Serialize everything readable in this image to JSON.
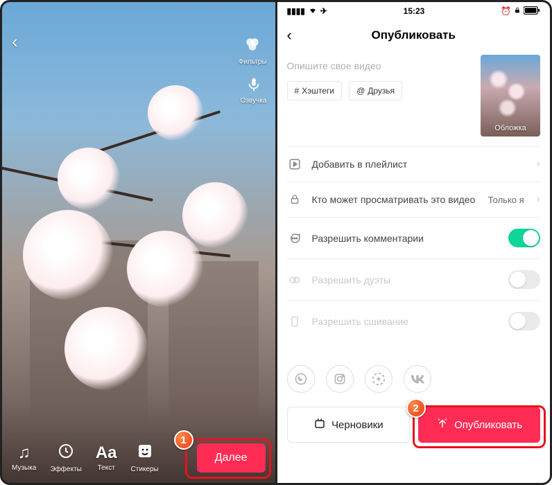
{
  "left": {
    "side": {
      "filters": "Фильтры",
      "voice": "Озвучка"
    },
    "tools": {
      "music": "Музыка",
      "effects": "Эффекты",
      "text": "Текст",
      "stickers": "Стикеры"
    },
    "next": "Далее",
    "badge": "1"
  },
  "right": {
    "status": {
      "time": "15:23"
    },
    "nav": {
      "title": "Опубликовать"
    },
    "compose": {
      "placeholder": "Опишите свое видео",
      "cover": "Обложка"
    },
    "chips": {
      "hashtags": "Хэштеги",
      "friends": "Друзья"
    },
    "rows": {
      "playlist": "Добавить в плейлист",
      "privacy_label": "Кто может просматривать это видео",
      "privacy_value": "Только я",
      "comments": "Разрешить комментарии",
      "duets": "Разрешить дуэты",
      "stitch": "Разрешить сшивание"
    },
    "buttons": {
      "drafts": "Черновики",
      "publish": "Опубликовать"
    },
    "badge": "2"
  }
}
